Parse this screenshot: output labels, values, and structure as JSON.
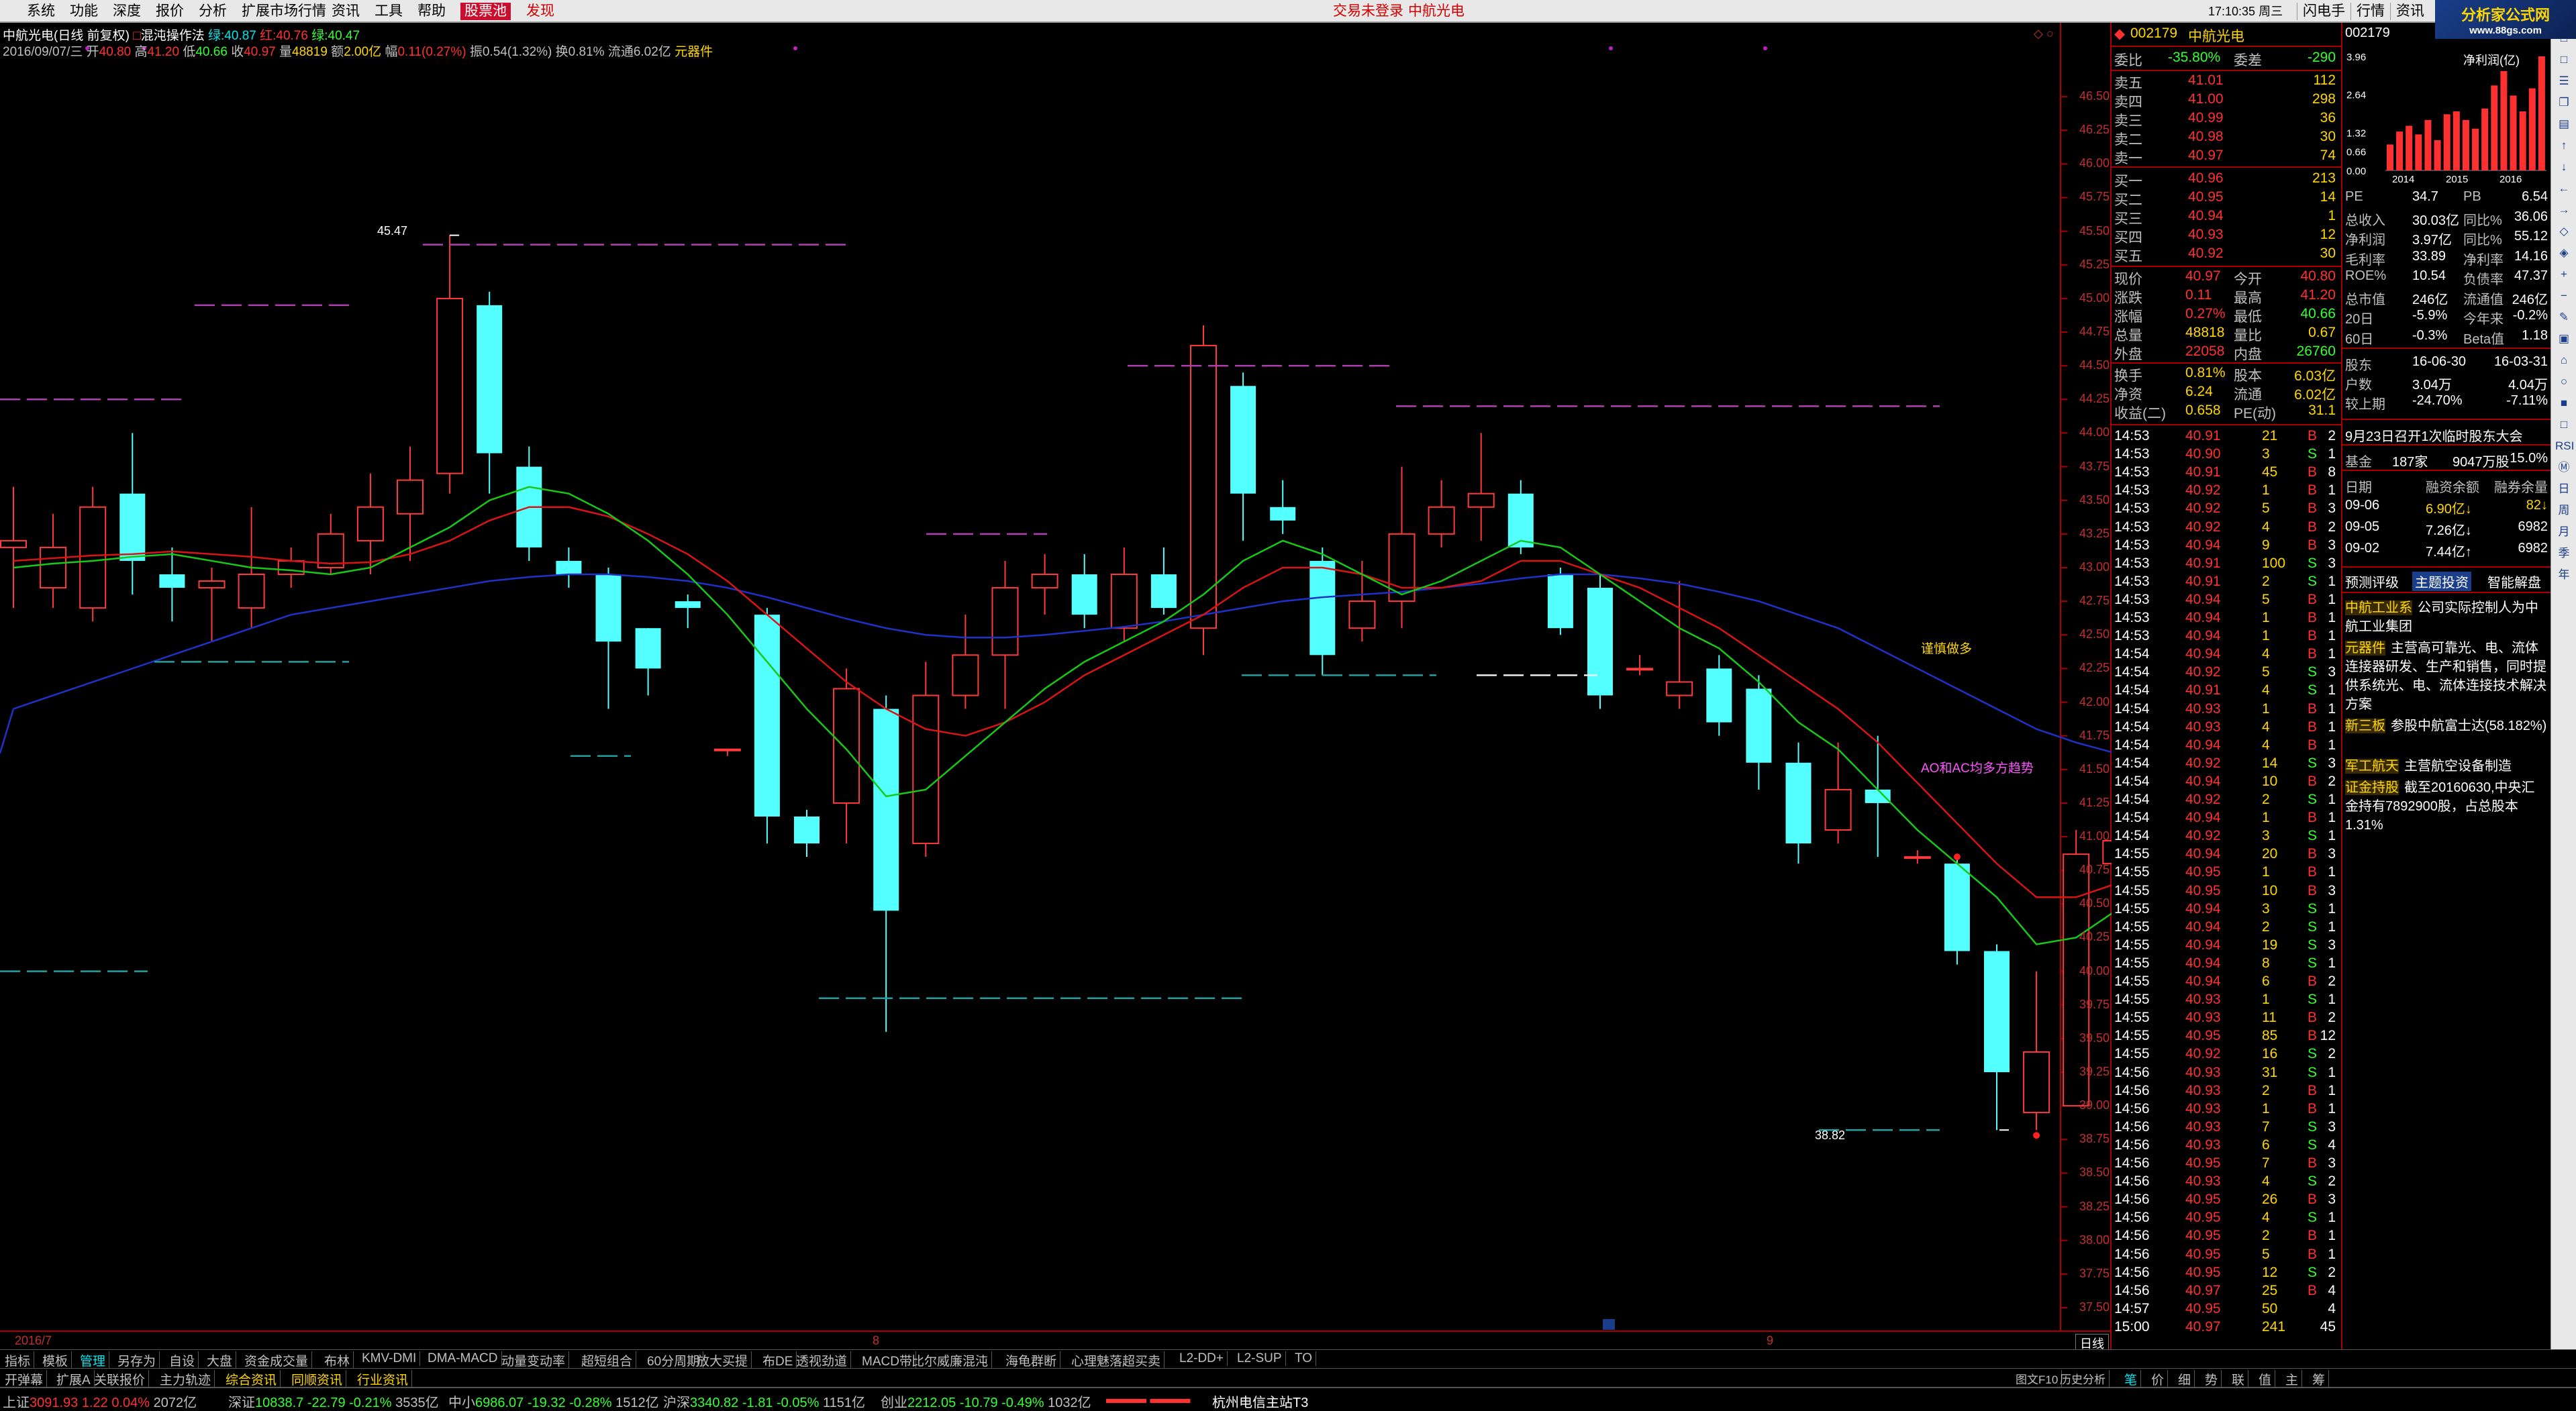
{
  "menu": {
    "items": [
      "系统",
      "功能",
      "深度",
      "报价",
      "分析",
      "扩展市场行情",
      "资讯",
      "工具",
      "帮助"
    ],
    "hot": "股票池",
    "discover": "发现",
    "trade_login": "交易未登录",
    "stock_name": "中航光电",
    "time": "17:10:35 周三",
    "sys_buttons": [
      "闪电手",
      "行情",
      "资讯"
    ]
  },
  "logo": {
    "line1": "分析家公式网",
    "line2": "www.88gs.com"
  },
  "chart": {
    "title": "中航光电(日线 前复权)",
    "indicator": "混沌操作法",
    "ma5_label": "绿:40.87",
    "ma10_label": "红:40.76",
    "ma20_label": "绿:40.47",
    "ohlc": {
      "date": "2016/09/07/三",
      "open_k": "开",
      "open": "40.80",
      "high_k": "高",
      "high": "41.20",
      "low_k": "低",
      "low": "40.66",
      "close_k": "收",
      "close": "40.97",
      "vol_k": "量",
      "vol": "48819",
      "amt_k": "额",
      "amt": "2.00亿",
      "chg_k": "幅",
      "chg": "0.11(0.27%)",
      "amp": "振0.54(1.32%)",
      "turn": "换0.81%",
      "float": "流通6.02亿",
      "sector": "元器件"
    },
    "high_label": "45.47",
    "low_label": "38.82",
    "annot1": "谨慎做多",
    "annot2": "AO和AC均多方趋势",
    "date_labels": [
      "2016/7",
      "8",
      "9"
    ],
    "y_ticks": [
      "46.50",
      "46.25",
      "46.00",
      "45.75",
      "45.50",
      "45.25",
      "45.00",
      "44.75",
      "44.50",
      "44.25",
      "44.00",
      "43.75",
      "43.50",
      "43.25",
      "43.00",
      "42.75",
      "42.50",
      "42.25",
      "42.00",
      "41.75",
      "41.50",
      "41.25",
      "41.00",
      "40.75",
      "40.50",
      "40.25",
      "40.00",
      "39.75",
      "39.50",
      "39.25",
      "39.00",
      "38.75",
      "38.50",
      "38.25",
      "38.00",
      "37.75",
      "37.50"
    ],
    "freq": "日线"
  },
  "chart_data": {
    "type": "candlestick",
    "ylim": [
      37.4,
      46.65
    ],
    "candles": [
      {
        "o": 43.15,
        "c": 43.2,
        "h": 43.6,
        "l": 42.7
      },
      {
        "o": 42.85,
        "c": 43.15,
        "h": 43.4,
        "l": 42.7
      },
      {
        "o": 42.7,
        "c": 43.45,
        "h": 43.6,
        "l": 42.6
      },
      {
        "o": 43.55,
        "c": 43.05,
        "h": 44.0,
        "l": 42.8
      },
      {
        "o": 42.95,
        "c": 42.85,
        "h": 43.15,
        "l": 42.6
      },
      {
        "o": 42.85,
        "c": 42.9,
        "h": 43.0,
        "l": 42.45
      },
      {
        "o": 42.7,
        "c": 42.95,
        "h": 43.45,
        "l": 42.55
      },
      {
        "o": 42.95,
        "c": 43.05,
        "h": 43.15,
        "l": 42.85
      },
      {
        "o": 43.0,
        "c": 43.25,
        "h": 43.4,
        "l": 42.95
      },
      {
        "o": 43.2,
        "c": 43.45,
        "h": 43.7,
        "l": 42.95
      },
      {
        "o": 43.4,
        "c": 43.65,
        "h": 43.9,
        "l": 43.05
      },
      {
        "o": 43.7,
        "c": 45.0,
        "h": 45.47,
        "l": 43.55
      },
      {
        "o": 44.95,
        "c": 43.85,
        "h": 45.05,
        "l": 43.55
      },
      {
        "o": 43.75,
        "c": 43.15,
        "h": 43.9,
        "l": 43.05
      },
      {
        "o": 43.05,
        "c": 42.95,
        "h": 43.15,
        "l": 42.85
      },
      {
        "o": 42.95,
        "c": 42.45,
        "h": 43.0,
        "l": 41.95
      },
      {
        "o": 42.55,
        "c": 42.25,
        "h": 42.55,
        "l": 42.05
      },
      {
        "o": 42.75,
        "c": 42.7,
        "h": 42.8,
        "l": 42.55
      },
      {
        "o": 41.65,
        "c": 41.65,
        "h": 41.65,
        "l": 41.6
      },
      {
        "o": 42.65,
        "c": 41.15,
        "h": 42.7,
        "l": 40.95
      },
      {
        "o": 41.15,
        "c": 40.95,
        "h": 41.2,
        "l": 40.85
      },
      {
        "o": 41.25,
        "c": 42.1,
        "h": 42.25,
        "l": 40.95
      },
      {
        "o": 41.95,
        "c": 40.45,
        "h": 42.05,
        "l": 39.55
      },
      {
        "o": 40.95,
        "c": 42.05,
        "h": 42.3,
        "l": 40.85
      },
      {
        "o": 42.05,
        "c": 42.35,
        "h": 42.65,
        "l": 41.95
      },
      {
        "o": 42.35,
        "c": 42.85,
        "h": 43.05,
        "l": 41.95
      },
      {
        "o": 42.85,
        "c": 42.95,
        "h": 43.1,
        "l": 42.65
      },
      {
        "o": 42.95,
        "c": 42.65,
        "h": 43.1,
        "l": 42.55
      },
      {
        "o": 42.55,
        "c": 42.95,
        "h": 43.15,
        "l": 42.45
      },
      {
        "o": 42.95,
        "c": 42.7,
        "h": 43.15,
        "l": 42.65
      },
      {
        "o": 42.55,
        "c": 44.65,
        "h": 44.8,
        "l": 42.35
      },
      {
        "o": 44.35,
        "c": 43.55,
        "h": 44.45,
        "l": 43.2
      },
      {
        "o": 43.45,
        "c": 43.35,
        "h": 43.65,
        "l": 43.25
      },
      {
        "o": 43.05,
        "c": 42.35,
        "h": 43.15,
        "l": 42.2
      },
      {
        "o": 42.55,
        "c": 42.75,
        "h": 43.05,
        "l": 42.45
      },
      {
        "o": 42.75,
        "c": 43.25,
        "h": 43.75,
        "l": 42.55
      },
      {
        "o": 43.25,
        "c": 43.45,
        "h": 43.65,
        "l": 43.15
      },
      {
        "o": 43.45,
        "c": 43.55,
        "h": 44.0,
        "l": 43.2
      },
      {
        "o": 43.55,
        "c": 43.15,
        "h": 43.65,
        "l": 43.1
      },
      {
        "o": 42.95,
        "c": 42.55,
        "h": 43.0,
        "l": 42.5
      },
      {
        "o": 42.85,
        "c": 42.05,
        "h": 42.95,
        "l": 41.95
      },
      {
        "o": 42.25,
        "c": 42.25,
        "h": 42.35,
        "l": 42.2
      },
      {
        "o": 42.05,
        "c": 42.15,
        "h": 42.9,
        "l": 41.95
      },
      {
        "o": 42.25,
        "c": 41.85,
        "h": 42.35,
        "l": 41.75
      },
      {
        "o": 42.1,
        "c": 41.55,
        "h": 42.2,
        "l": 41.35
      },
      {
        "o": 41.55,
        "c": 40.95,
        "h": 41.7,
        "l": 40.8
      },
      {
        "o": 41.05,
        "c": 41.35,
        "h": 41.7,
        "l": 40.95
      },
      {
        "o": 41.35,
        "c": 41.25,
        "h": 41.75,
        "l": 40.85
      },
      {
        "o": 40.85,
        "c": 40.85,
        "h": 40.9,
        "l": 40.8
      },
      {
        "o": 40.8,
        "c": 40.15,
        "h": 40.85,
        "l": 40.05
      },
      {
        "o": 40.15,
        "c": 39.25,
        "h": 40.2,
        "l": 38.82
      },
      {
        "o": 38.95,
        "c": 39.4,
        "h": 40.0,
        "l": 38.82
      },
      {
        "o": 39.0,
        "c": 40.87,
        "h": 41.05,
        "l": 39.35
      },
      {
        "o": 40.8,
        "c": 40.97,
        "h": 41.2,
        "l": 40.66
      }
    ],
    "ma_green": [
      43.0,
      43.03,
      43.05,
      43.08,
      43.1,
      43.05,
      43.0,
      42.98,
      42.95,
      43.0,
      43.15,
      43.3,
      43.5,
      43.6,
      43.55,
      43.4,
      43.2,
      42.95,
      42.65,
      42.3,
      41.95,
      41.65,
      41.3,
      41.35,
      41.6,
      41.85,
      42.1,
      42.3,
      42.45,
      42.6,
      42.8,
      43.05,
      43.2,
      43.1,
      42.95,
      42.8,
      42.9,
      43.05,
      43.2,
      43.15,
      42.95,
      42.75,
      42.55,
      42.4,
      42.15,
      41.85,
      41.65,
      41.35,
      41.05,
      40.8,
      40.55,
      40.2,
      40.25,
      40.45
    ],
    "ma_red": [
      43.05,
      43.07,
      43.09,
      43.1,
      43.12,
      43.1,
      43.08,
      43.05,
      43.03,
      43.04,
      43.1,
      43.2,
      43.35,
      43.45,
      43.45,
      43.38,
      43.25,
      43.1,
      42.9,
      42.65,
      42.4,
      42.15,
      41.95,
      41.8,
      41.75,
      41.85,
      42.0,
      42.2,
      42.35,
      42.5,
      42.65,
      42.85,
      43.0,
      43.0,
      42.95,
      42.85,
      42.85,
      42.9,
      43.05,
      43.05,
      42.95,
      42.85,
      42.7,
      42.55,
      42.35,
      42.15,
      41.95,
      41.7,
      41.4,
      41.1,
      40.8,
      40.55,
      40.55,
      40.65
    ],
    "ma_blue": [
      41.95,
      42.05,
      42.15,
      42.25,
      42.35,
      42.45,
      42.55,
      42.65,
      42.7,
      42.75,
      42.8,
      42.85,
      42.9,
      42.93,
      42.95,
      42.95,
      42.93,
      42.9,
      42.85,
      42.78,
      42.7,
      42.62,
      42.55,
      42.5,
      42.48,
      42.48,
      42.5,
      42.53,
      42.56,
      42.6,
      42.65,
      42.7,
      42.75,
      42.78,
      42.8,
      42.82,
      42.85,
      42.88,
      42.92,
      42.95,
      42.95,
      42.92,
      42.88,
      42.82,
      42.75,
      42.65,
      42.55,
      42.4,
      42.25,
      42.1,
      41.95,
      41.8,
      41.7,
      41.62
    ]
  },
  "quote": {
    "code": "002179",
    "name": "中航光电",
    "weibi_k": "委比",
    "weibi": "-35.80%",
    "weicha_k": "委差",
    "weicha": "-290",
    "asks": [
      {
        "label": "卖五",
        "price": "41.01",
        "vol": "112"
      },
      {
        "label": "卖四",
        "price": "41.00",
        "vol": "298"
      },
      {
        "label": "卖三",
        "price": "40.99",
        "vol": "36"
      },
      {
        "label": "卖二",
        "price": "40.98",
        "vol": "30"
      },
      {
        "label": "卖一",
        "price": "40.97",
        "vol": "74"
      }
    ],
    "bids": [
      {
        "label": "买一",
        "price": "40.96",
        "vol": "213"
      },
      {
        "label": "买二",
        "price": "40.95",
        "vol": "14"
      },
      {
        "label": "买三",
        "price": "40.94",
        "vol": "1"
      },
      {
        "label": "买四",
        "price": "40.93",
        "vol": "12"
      },
      {
        "label": "买五",
        "price": "40.92",
        "vol": "30"
      }
    ],
    "stats": [
      {
        "k1": "现价",
        "v1": "40.97",
        "k2": "今开",
        "v2": "40.80",
        "c1": "red",
        "c2": "red"
      },
      {
        "k1": "涨跌",
        "v1": "0.11",
        "k2": "最高",
        "v2": "41.20",
        "c1": "red",
        "c2": "red"
      },
      {
        "k1": "涨幅",
        "v1": "0.27%",
        "k2": "最低",
        "v2": "40.66",
        "c1": "red",
        "c2": "grn"
      },
      {
        "k1": "总量",
        "v1": "48818",
        "k2": "量比",
        "v2": "0.67",
        "c1": "yel",
        "c2": "yel"
      },
      {
        "k1": "外盘",
        "v1": "22058",
        "k2": "内盘",
        "v2": "26760",
        "c1": "red",
        "c2": "grn"
      }
    ],
    "stats2": [
      {
        "k1": "换手",
        "v1": "0.81%",
        "k2": "股本",
        "v2": "6.03亿"
      },
      {
        "k1": "净资",
        "v1": "6.24",
        "k2": "流通",
        "v2": "6.02亿"
      },
      {
        "k1": "收益(二)",
        "v1": "0.658",
        "k2": "PE(动)",
        "v2": "31.1"
      }
    ],
    "ticks": [
      [
        "14:53",
        "40.91",
        "21",
        "B",
        "2"
      ],
      [
        "14:53",
        "40.90",
        "3",
        "S",
        "1"
      ],
      [
        "14:53",
        "40.91",
        "45",
        "B",
        "8"
      ],
      [
        "14:53",
        "40.92",
        "1",
        "B",
        "1"
      ],
      [
        "14:53",
        "40.92",
        "5",
        "B",
        "3"
      ],
      [
        "14:53",
        "40.92",
        "4",
        "B",
        "2"
      ],
      [
        "14:53",
        "40.94",
        "9",
        "B",
        "3"
      ],
      [
        "14:53",
        "40.91",
        "100",
        "S",
        "3"
      ],
      [
        "14:53",
        "40.91",
        "2",
        "S",
        "1"
      ],
      [
        "14:53",
        "40.94",
        "5",
        "B",
        "1"
      ],
      [
        "14:53",
        "40.94",
        "1",
        "B",
        "1"
      ],
      [
        "14:53",
        "40.94",
        "1",
        "B",
        "1"
      ],
      [
        "14:54",
        "40.94",
        "4",
        "B",
        "1"
      ],
      [
        "14:54",
        "40.92",
        "5",
        "S",
        "3"
      ],
      [
        "14:54",
        "40.91",
        "4",
        "S",
        "1"
      ],
      [
        "14:54",
        "40.93",
        "1",
        "B",
        "1"
      ],
      [
        "14:54",
        "40.93",
        "4",
        "B",
        "1"
      ],
      [
        "14:54",
        "40.94",
        "4",
        "B",
        "1"
      ],
      [
        "14:54",
        "40.92",
        "14",
        "S",
        "3"
      ],
      [
        "14:54",
        "40.94",
        "10",
        "B",
        "2"
      ],
      [
        "14:54",
        "40.92",
        "2",
        "S",
        "1"
      ],
      [
        "14:54",
        "40.94",
        "1",
        "B",
        "1"
      ],
      [
        "14:54",
        "40.92",
        "3",
        "S",
        "1"
      ],
      [
        "14:55",
        "40.94",
        "20",
        "B",
        "3"
      ],
      [
        "14:55",
        "40.95",
        "1",
        "B",
        "1"
      ],
      [
        "14:55",
        "40.95",
        "10",
        "B",
        "3"
      ],
      [
        "14:55",
        "40.94",
        "3",
        "S",
        "1"
      ],
      [
        "14:55",
        "40.94",
        "2",
        "S",
        "1"
      ],
      [
        "14:55",
        "40.94",
        "19",
        "S",
        "3"
      ],
      [
        "14:55",
        "40.94",
        "8",
        "S",
        "1"
      ],
      [
        "14:55",
        "40.94",
        "6",
        "B",
        "2"
      ],
      [
        "14:55",
        "40.93",
        "1",
        "S",
        "1"
      ],
      [
        "14:55",
        "40.93",
        "11",
        "B",
        "2"
      ],
      [
        "14:55",
        "40.95",
        "85",
        "B",
        "12"
      ],
      [
        "14:55",
        "40.92",
        "16",
        "S",
        "2"
      ],
      [
        "14:56",
        "40.93",
        "31",
        "S",
        "1"
      ],
      [
        "14:56",
        "40.93",
        "2",
        "B",
        "1"
      ],
      [
        "14:56",
        "40.93",
        "1",
        "B",
        "1"
      ],
      [
        "14:56",
        "40.93",
        "7",
        "S",
        "3"
      ],
      [
        "14:56",
        "40.93",
        "6",
        "S",
        "4"
      ],
      [
        "14:56",
        "40.95",
        "7",
        "B",
        "3"
      ],
      [
        "14:56",
        "40.93",
        "4",
        "S",
        "2"
      ],
      [
        "14:56",
        "40.95",
        "26",
        "B",
        "3"
      ],
      [
        "14:56",
        "40.95",
        "4",
        "S",
        "1"
      ],
      [
        "14:56",
        "40.95",
        "2",
        "B",
        "1"
      ],
      [
        "14:56",
        "40.95",
        "5",
        "B",
        "1"
      ],
      [
        "14:56",
        "40.95",
        "12",
        "S",
        "2"
      ],
      [
        "14:56",
        "40.97",
        "25",
        "B",
        "4"
      ],
      [
        "14:57",
        "40.95",
        "50",
        "",
        "4"
      ],
      [
        "15:00",
        "40.97",
        "241",
        "",
        "45"
      ]
    ]
  },
  "info": {
    "code": "002179",
    "profit_title": "净利润(亿)",
    "profit_ticks": [
      "3.96",
      "2.64",
      "1.32",
      "0.66",
      "0.00"
    ],
    "profit_years": [
      "2014",
      "2015",
      "2016"
    ],
    "profit_bars": [
      0.9,
      1.35,
      1.55,
      1.25,
      1.75,
      1.05,
      1.95,
      2.05,
      1.75,
      1.45,
      2.15,
      2.95,
      3.45,
      2.6,
      2.05,
      2.85,
      3.96
    ],
    "fin": [
      {
        "k1": "PE",
        "v1": "34.7",
        "k2": "PB",
        "v2": "6.54"
      },
      {
        "k1": "总收入",
        "v1": "30.03亿",
        "k2": "同比%",
        "v2": "36.06"
      },
      {
        "k1": "净利润",
        "v1": "3.97亿",
        "k2": "同比%",
        "v2": "55.12"
      },
      {
        "k1": "毛利率",
        "v1": "33.89",
        "k2": "净利率",
        "v2": "14.16"
      },
      {
        "k1": "ROE%",
        "v1": "10.54",
        "k2": "负债率",
        "v2": "47.37"
      },
      {
        "k1": "总市值",
        "v1": "246亿",
        "k2": "流通值",
        "v2": "246亿"
      },
      {
        "k1": "20日",
        "v1": "-5.9%",
        "k2": "今年来",
        "v2": "-0.2%"
      },
      {
        "k1": "60日",
        "v1": "-0.3%",
        "k2": "Beta值",
        "v2": "1.18"
      }
    ],
    "holders": [
      {
        "k": "股东",
        "v1": "16-06-30",
        "v2": "16-03-31"
      },
      {
        "k": "户数",
        "v1": "3.04万",
        "v2": "4.04万"
      },
      {
        "k": "较上期",
        "v1": "-24.70%",
        "v2": "-7.11%"
      }
    ],
    "meeting": "9月23日召开1次临时股东大会",
    "fund": {
      "k": "基金",
      "count": "187家",
      "shares": "9047万股",
      "pct": "15.0%"
    },
    "margin_header": {
      "date": "日期",
      "bal": "融资余额",
      "sec": "融券余量"
    },
    "margin": [
      {
        "date": "09-06",
        "bal": "6.90亿↓",
        "sec": "82↓"
      },
      {
        "date": "09-05",
        "bal": "7.26亿↓",
        "sec": "6982"
      },
      {
        "date": "09-02",
        "bal": "7.44亿↑",
        "sec": "6982"
      }
    ],
    "tabs": [
      "预测评级",
      "主题投资",
      "智能解盘"
    ],
    "themes": [
      {
        "tag": "中航工业系",
        "text": "公司实际控制人为中航工业集团"
      },
      {
        "tag": "元器件",
        "text": "主营高可靠光、电、流体连接器研发、生产和销售，同时提供系统光、电、流体连接技术解决方案"
      },
      {
        "tag": "新三板",
        "text": "参股中航富士达(58.182%)"
      },
      {
        "tag": "军工航天",
        "text": "主营航空设备制造"
      },
      {
        "tag": "证金持股",
        "text": "截至20160630,中央汇金持有7892900股，占总股本1.31%"
      }
    ]
  },
  "tools": [
    "□",
    "□",
    "☰",
    "❐",
    "▤",
    "↑",
    "↓",
    "←",
    "→",
    "◇",
    "◈",
    "+",
    "−",
    "✎",
    "▣",
    "⌂",
    "○",
    "■",
    "□",
    "RSI",
    "Ⓜ",
    "日",
    "周",
    "月",
    "季",
    "年"
  ],
  "tabs": [
    "指标",
    "模板",
    "管理",
    "另存为",
    "自设",
    "大盘",
    "资金成交量",
    "布林",
    "KMV-DMI",
    "DMA-MACD",
    "动量变动率",
    "超短组合",
    "60分周期",
    "放大买提",
    "布DE",
    "透视劲道",
    "MACD带",
    "比尔威廉混沌",
    "海龟群断",
    "心理魅落超买卖",
    "L2-DD+",
    "L2-SUP",
    "TO"
  ],
  "tabs_active": 2,
  "tabs2": [
    "开弹幕",
    "扩展A",
    "关联报价",
    "主力轨迹",
    "综合资讯",
    "同顺资讯",
    "行业资讯"
  ],
  "bottom_right": [
    "图文F10",
    "历史分析"
  ],
  "bottom_tabs": [
    "笔",
    "价",
    "细",
    "势",
    "联",
    "值",
    "主",
    "筹"
  ],
  "status": {
    "sh": {
      "name": "上证",
      "val": "3091.93",
      "chg": "1.22",
      "pct": "0.04%",
      "amt": "2072亿"
    },
    "sz": {
      "name": "深证",
      "val": "10838.7",
      "chg": "-22.79",
      "pct": "-0.21%",
      "amt": "3535亿"
    },
    "zx": {
      "name": "中小",
      "val": "6986.07",
      "chg": "-19.32",
      "pct": "-0.28%",
      "amt": "1512亿"
    },
    "hs": {
      "name": "沪深",
      "val": "3340.82",
      "chg": "-1.81",
      "pct": "-0.05%",
      "amt": "1151亿"
    },
    "cy": {
      "name": "创业",
      "val": "2212.05",
      "chg": "-10.79",
      "pct": "-0.49%",
      "amt": "1032亿"
    },
    "server": "杭州电信主站T3"
  }
}
